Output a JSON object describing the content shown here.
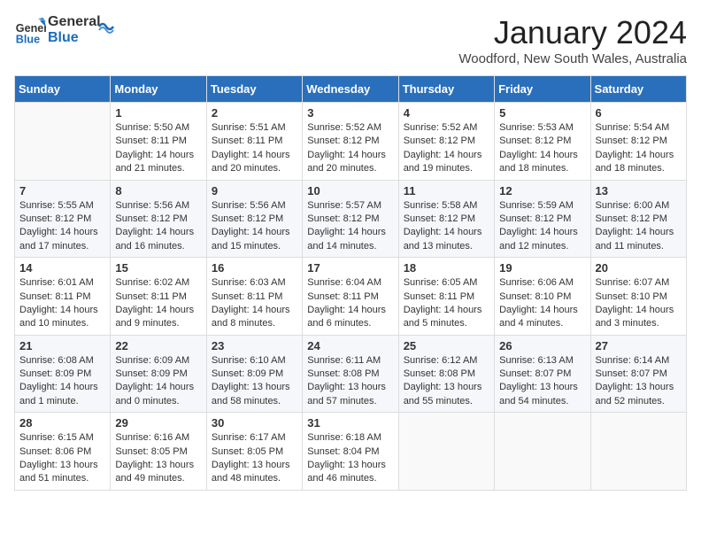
{
  "header": {
    "logo_text_general": "General",
    "logo_text_blue": "Blue",
    "month_year": "January 2024",
    "location": "Woodford, New South Wales, Australia"
  },
  "weekdays": [
    "Sunday",
    "Monday",
    "Tuesday",
    "Wednesday",
    "Thursday",
    "Friday",
    "Saturday"
  ],
  "weeks": [
    [
      {
        "day": "",
        "content": ""
      },
      {
        "day": "1",
        "content": "Sunrise: 5:50 AM\nSunset: 8:11 PM\nDaylight: 14 hours\nand 21 minutes."
      },
      {
        "day": "2",
        "content": "Sunrise: 5:51 AM\nSunset: 8:11 PM\nDaylight: 14 hours\nand 20 minutes."
      },
      {
        "day": "3",
        "content": "Sunrise: 5:52 AM\nSunset: 8:12 PM\nDaylight: 14 hours\nand 20 minutes."
      },
      {
        "day": "4",
        "content": "Sunrise: 5:52 AM\nSunset: 8:12 PM\nDaylight: 14 hours\nand 19 minutes."
      },
      {
        "day": "5",
        "content": "Sunrise: 5:53 AM\nSunset: 8:12 PM\nDaylight: 14 hours\nand 18 minutes."
      },
      {
        "day": "6",
        "content": "Sunrise: 5:54 AM\nSunset: 8:12 PM\nDaylight: 14 hours\nand 18 minutes."
      }
    ],
    [
      {
        "day": "7",
        "content": "Sunrise: 5:55 AM\nSunset: 8:12 PM\nDaylight: 14 hours\nand 17 minutes."
      },
      {
        "day": "8",
        "content": "Sunrise: 5:56 AM\nSunset: 8:12 PM\nDaylight: 14 hours\nand 16 minutes."
      },
      {
        "day": "9",
        "content": "Sunrise: 5:56 AM\nSunset: 8:12 PM\nDaylight: 14 hours\nand 15 minutes."
      },
      {
        "day": "10",
        "content": "Sunrise: 5:57 AM\nSunset: 8:12 PM\nDaylight: 14 hours\nand 14 minutes."
      },
      {
        "day": "11",
        "content": "Sunrise: 5:58 AM\nSunset: 8:12 PM\nDaylight: 14 hours\nand 13 minutes."
      },
      {
        "day": "12",
        "content": "Sunrise: 5:59 AM\nSunset: 8:12 PM\nDaylight: 14 hours\nand 12 minutes."
      },
      {
        "day": "13",
        "content": "Sunrise: 6:00 AM\nSunset: 8:12 PM\nDaylight: 14 hours\nand 11 minutes."
      }
    ],
    [
      {
        "day": "14",
        "content": "Sunrise: 6:01 AM\nSunset: 8:11 PM\nDaylight: 14 hours\nand 10 minutes."
      },
      {
        "day": "15",
        "content": "Sunrise: 6:02 AM\nSunset: 8:11 PM\nDaylight: 14 hours\nand 9 minutes."
      },
      {
        "day": "16",
        "content": "Sunrise: 6:03 AM\nSunset: 8:11 PM\nDaylight: 14 hours\nand 8 minutes."
      },
      {
        "day": "17",
        "content": "Sunrise: 6:04 AM\nSunset: 8:11 PM\nDaylight: 14 hours\nand 6 minutes."
      },
      {
        "day": "18",
        "content": "Sunrise: 6:05 AM\nSunset: 8:11 PM\nDaylight: 14 hours\nand 5 minutes."
      },
      {
        "day": "19",
        "content": "Sunrise: 6:06 AM\nSunset: 8:10 PM\nDaylight: 14 hours\nand 4 minutes."
      },
      {
        "day": "20",
        "content": "Sunrise: 6:07 AM\nSunset: 8:10 PM\nDaylight: 14 hours\nand 3 minutes."
      }
    ],
    [
      {
        "day": "21",
        "content": "Sunrise: 6:08 AM\nSunset: 8:09 PM\nDaylight: 14 hours\nand 1 minute."
      },
      {
        "day": "22",
        "content": "Sunrise: 6:09 AM\nSunset: 8:09 PM\nDaylight: 14 hours\nand 0 minutes."
      },
      {
        "day": "23",
        "content": "Sunrise: 6:10 AM\nSunset: 8:09 PM\nDaylight: 13 hours\nand 58 minutes."
      },
      {
        "day": "24",
        "content": "Sunrise: 6:11 AM\nSunset: 8:08 PM\nDaylight: 13 hours\nand 57 minutes."
      },
      {
        "day": "25",
        "content": "Sunrise: 6:12 AM\nSunset: 8:08 PM\nDaylight: 13 hours\nand 55 minutes."
      },
      {
        "day": "26",
        "content": "Sunrise: 6:13 AM\nSunset: 8:07 PM\nDaylight: 13 hours\nand 54 minutes."
      },
      {
        "day": "27",
        "content": "Sunrise: 6:14 AM\nSunset: 8:07 PM\nDaylight: 13 hours\nand 52 minutes."
      }
    ],
    [
      {
        "day": "28",
        "content": "Sunrise: 6:15 AM\nSunset: 8:06 PM\nDaylight: 13 hours\nand 51 minutes."
      },
      {
        "day": "29",
        "content": "Sunrise: 6:16 AM\nSunset: 8:05 PM\nDaylight: 13 hours\nand 49 minutes."
      },
      {
        "day": "30",
        "content": "Sunrise: 6:17 AM\nSunset: 8:05 PM\nDaylight: 13 hours\nand 48 minutes."
      },
      {
        "day": "31",
        "content": "Sunrise: 6:18 AM\nSunset: 8:04 PM\nDaylight: 13 hours\nand 46 minutes."
      },
      {
        "day": "",
        "content": ""
      },
      {
        "day": "",
        "content": ""
      },
      {
        "day": "",
        "content": ""
      }
    ]
  ]
}
